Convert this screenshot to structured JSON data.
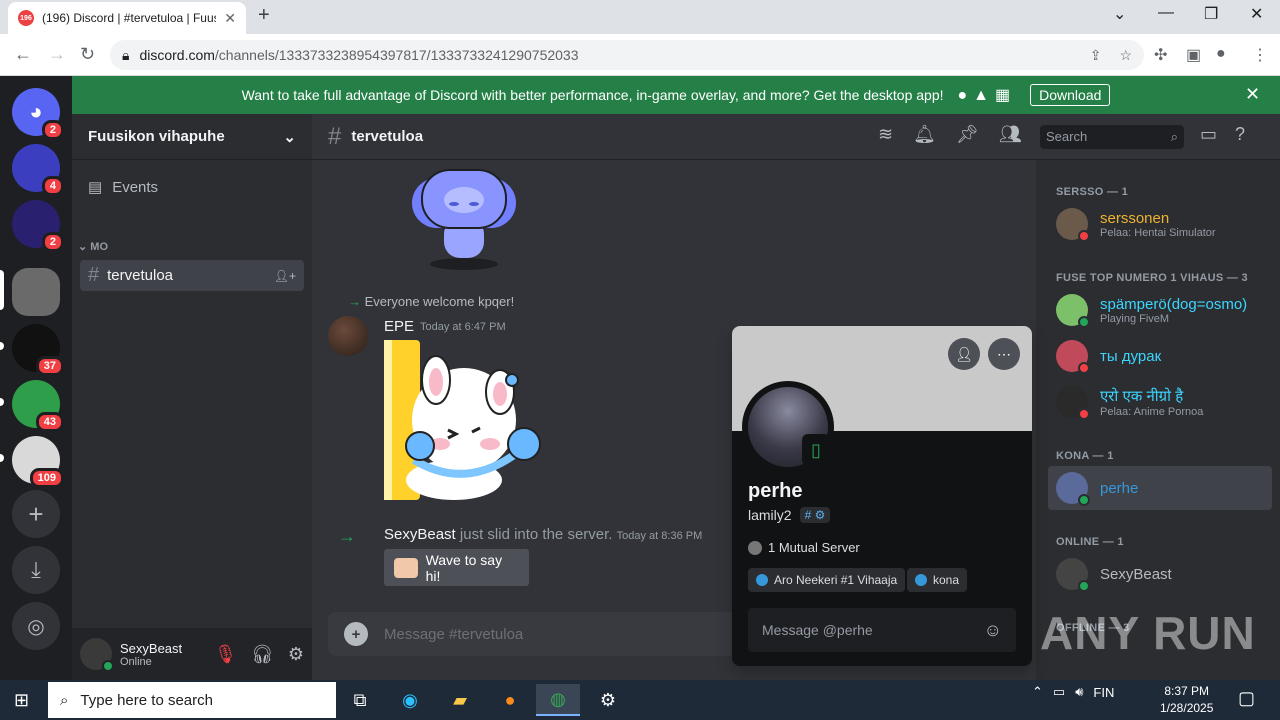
{
  "browser": {
    "tab_title": "(196) Discord | #tervetuloa | Fuus",
    "tab_favicon_badge": "196",
    "url_host": "discord.com",
    "url_path": "/channels/1333733238954397817/1333733241290752033"
  },
  "banner": {
    "text": "Want to take full advantage of Discord with better performance, in-game overlay, and more? Get the desktop app!",
    "download_label": "Download"
  },
  "servers": [
    {
      "name": "discord-home",
      "badge": "2",
      "color": "#5865f2"
    },
    {
      "name": "server-1",
      "badge": "4",
      "color": "#3b3fbf"
    },
    {
      "name": "server-2",
      "badge": "2",
      "color": "#2a2070"
    },
    {
      "name": "server-3",
      "badge": "",
      "color": "#6a6a6a"
    },
    {
      "name": "server-4",
      "badge": "37",
      "color": "#111111"
    },
    {
      "name": "server-5",
      "badge": "43",
      "color": "#2e9e4a"
    },
    {
      "name": "server-6",
      "badge": "109",
      "color": "#d9d9d9"
    }
  ],
  "guild": {
    "name": "Fuusikon vihapuhe",
    "events_label": "Events",
    "category": "MO",
    "channel": "tervetuloa"
  },
  "user_panel": {
    "name": "SexyBeast",
    "status": "Online"
  },
  "header": {
    "channel": "tervetuloa",
    "search_placeholder": "Search"
  },
  "messages": {
    "reply_text": "Everyone welcome kpqer!",
    "author": "EPE",
    "timestamp": "Today at 6:47 PM",
    "join_user": "SexyBeast",
    "join_text": "just slid into the server.",
    "join_time": "Today at 8:36 PM",
    "wave_label": "Wave to say hi!",
    "input_placeholder": "Message #tervetuloa"
  },
  "members": {
    "groups": [
      {
        "header": "SERSSO — 1",
        "items": [
          {
            "name": "serssonen",
            "activity": "Pelaa: Hentai Simulator",
            "color": "#f0b232"
          }
        ]
      },
      {
        "header": "FUSE TOP NUMERO 1 VIHAUS — 3",
        "items": [
          {
            "name": "spämperö(dog=osmo)",
            "activity": "Playing FiveM",
            "color": "#3cd5ff"
          },
          {
            "name": "ты дурак",
            "activity": "",
            "color": "#3cd5ff"
          },
          {
            "name": "एरो एक नीग्रो है",
            "activity": "Pelaa: Anime Pornoa",
            "color": "#3cd5ff"
          }
        ]
      },
      {
        "header": "KONA — 1",
        "items": [
          {
            "name": "perhe",
            "activity": "",
            "color": "#3498db"
          }
        ]
      },
      {
        "header": "ONLINE — 1",
        "items": [
          {
            "name": "SexyBeast",
            "activity": "",
            "color": "#b5bac1"
          }
        ]
      },
      {
        "header": "OFFLINE — 3",
        "items": []
      }
    ]
  },
  "popout": {
    "name": "perhe",
    "tag": "lamily2",
    "mutual": "1 Mutual Server",
    "roles": [
      "Aro Neekeri #1 Vihaaja",
      "kona"
    ],
    "message_placeholder": "Message @perhe"
  },
  "watermark": "ANY RUN",
  "taskbar": {
    "search_placeholder": "Type here to search",
    "language": "FIN",
    "time": "8:37 PM",
    "date": "1/28/2025"
  }
}
